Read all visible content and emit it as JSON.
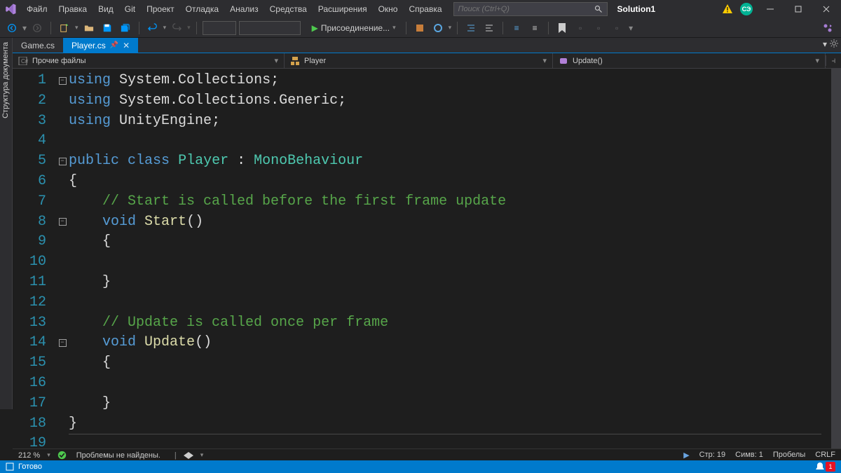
{
  "menu": {
    "items": [
      "Файл",
      "Правка",
      "Вид",
      "Git",
      "Проект",
      "Отладка",
      "Анализ",
      "Средства",
      "Расширения",
      "Окно",
      "Справка"
    ],
    "search_placeholder": "Поиск (Ctrl+Q)",
    "solution": "Solution1",
    "user_initials": "СЭ"
  },
  "toolbar": {
    "attach_label": "Присоединение..."
  },
  "tabs": [
    {
      "label": "Game.cs",
      "active": false
    },
    {
      "label": "Player.cs",
      "active": true
    }
  ],
  "nav": {
    "scope": "Прочие файлы",
    "class": "Player",
    "member": "Update()"
  },
  "side_panel": "Структура документа",
  "code": {
    "lines": [
      "1",
      "2",
      "3",
      "4",
      "5",
      "6",
      "7",
      "8",
      "9",
      "10",
      "11",
      "12",
      "13",
      "14",
      "15",
      "16",
      "17",
      "18",
      "19"
    ],
    "l1_kw": "using",
    "l1_ns": "System.Collections",
    "l2_kw": "using",
    "l2_ns": "System.Collections.Generic",
    "l3_kw": "using",
    "l3_ns": "UnityEngine",
    "l5_kw1": "public",
    "l5_kw2": "class",
    "l5_name": "Player",
    "l5_base": "MonoBehaviour",
    "l7_comment": "// Start is called before the first frame update",
    "l8_kw": "void",
    "l8_name": "Start",
    "l13_comment": "// Update is called once per frame",
    "l14_kw": "void",
    "l14_name": "Update",
    "brace_open": "{",
    "brace_close": "}",
    "paren": "()",
    ";": ";",
    " : ": " : "
  },
  "status_info": {
    "zoom": "212 %",
    "issues": "Проблемы не найдены.",
    "line": "Стр: 19",
    "col": "Симв: 1",
    "indent": "Пробелы",
    "eol": "CRLF"
  },
  "status_bar": {
    "ready": "Готово",
    "notif_count": "1"
  }
}
